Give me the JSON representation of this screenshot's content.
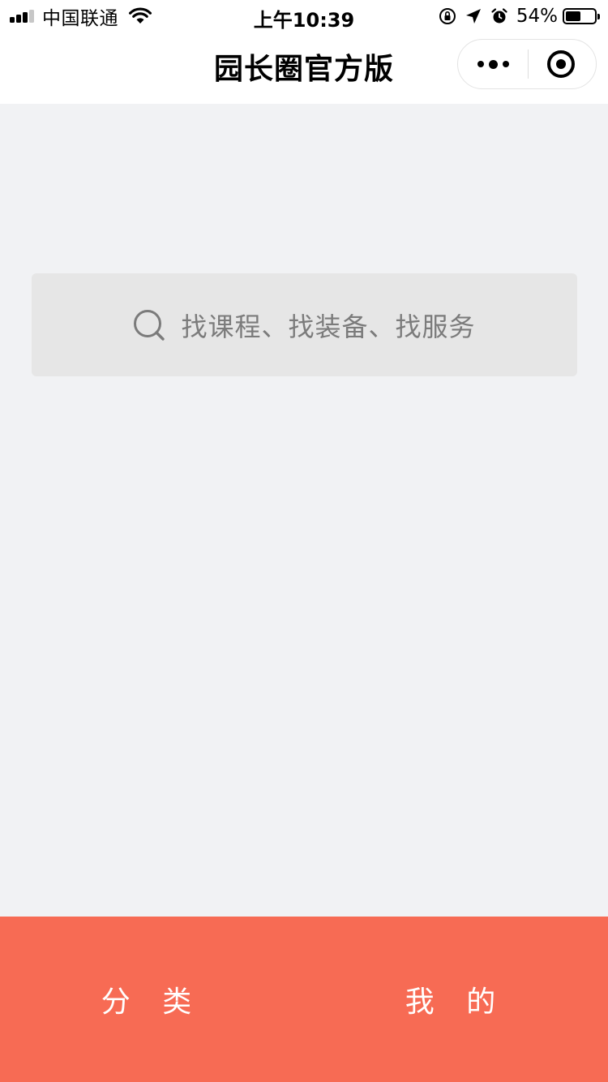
{
  "status_bar": {
    "carrier": "中国联通",
    "time": "上午10:39",
    "battery_percent": "54%",
    "battery_level": 0.54,
    "signal_bars_active": 3,
    "signal_bars_total": 4,
    "icons": [
      "signal-icon",
      "wifi-icon",
      "orientation-lock-icon",
      "location-arrow-icon",
      "alarm-clock-icon",
      "battery-icon"
    ]
  },
  "nav": {
    "title": "园长圈官方版",
    "capsule": {
      "more_icon": "more-dots-icon",
      "close_icon": "target-icon"
    }
  },
  "search": {
    "placeholder": "找课程、找装备、找服务",
    "icon": "search-icon"
  },
  "tab_bar": {
    "items": [
      {
        "label": "分 类"
      },
      {
        "label": "我 的"
      }
    ],
    "background": "#f76b54",
    "text_color": "#ffffff"
  },
  "colors": {
    "page_background": "#f1f2f4",
    "search_background": "#e6e6e6",
    "placeholder_text": "#7b7b7b",
    "accent": "#f76b54"
  }
}
